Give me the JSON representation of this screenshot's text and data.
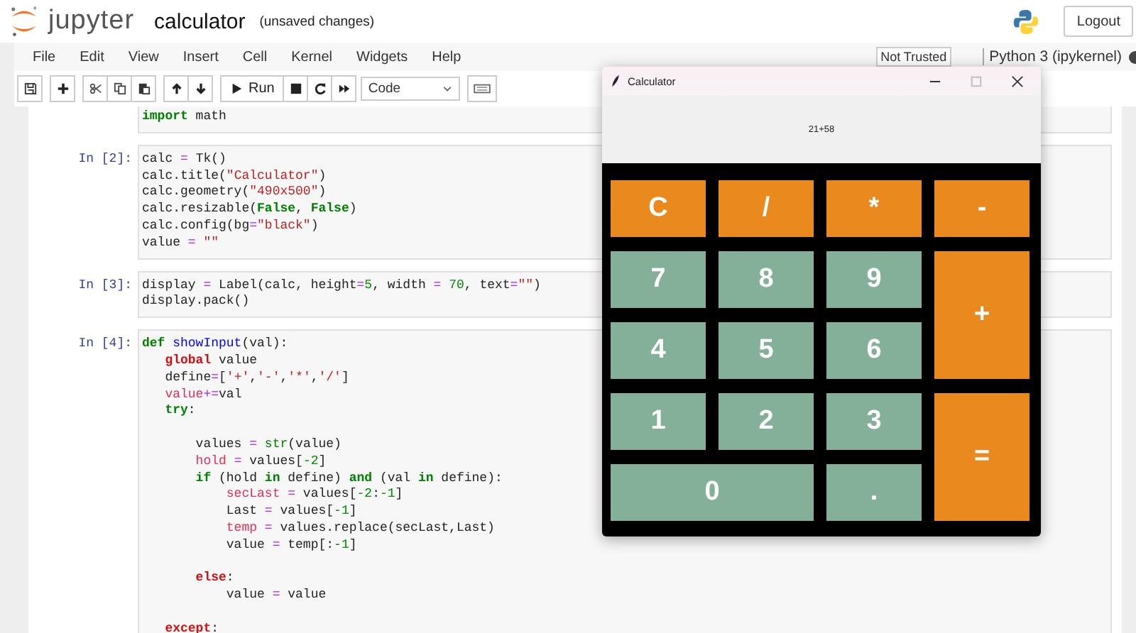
{
  "header": {
    "brand": "jupyter",
    "notebook_name": "calculator",
    "save_status": "(unsaved changes)",
    "logout": "Logout"
  },
  "menu": [
    "File",
    "Edit",
    "View",
    "Insert",
    "Cell",
    "Kernel",
    "Widgets",
    "Help"
  ],
  "trust": "Not Trusted",
  "kernel": "Python 3 (ipykernel)",
  "toolbar": {
    "run": "Run",
    "cell_type": "Code"
  },
  "cells": [
    {
      "lines": [
        {
          "tokens": [
            {
              "t": "import",
              "kind": "keyword"
            },
            {
              "t": " math",
              "kind": "plain"
            }
          ]
        }
      ]
    },
    {
      "prompt": "In [2]:",
      "lines": [
        {
          "tokens": [
            {
              "t": "calc ",
              "kind": "plain"
            },
            {
              "t": "=",
              "kind": "operator"
            },
            {
              "t": " Tk()",
              "kind": "plain"
            }
          ]
        },
        {
          "tokens": [
            {
              "t": "calc.title(",
              "kind": "plain"
            },
            {
              "t": "\"Calculator\"",
              "kind": "string"
            },
            {
              "t": ")",
              "kind": "plain"
            }
          ]
        },
        {
          "tokens": [
            {
              "t": "calc.geometry(",
              "kind": "plain"
            },
            {
              "t": "\"490x500\"",
              "kind": "string"
            },
            {
              "t": ")",
              "kind": "plain"
            }
          ]
        },
        {
          "tokens": [
            {
              "t": "calc.resizable(",
              "kind": "plain"
            },
            {
              "t": "False",
              "kind": "keyword"
            },
            {
              "t": ", ",
              "kind": "plain"
            },
            {
              "t": "False",
              "kind": "keyword"
            },
            {
              "t": ")",
              "kind": "plain"
            }
          ]
        },
        {
          "tokens": [
            {
              "t": "calc.config(bg",
              "kind": "plain"
            },
            {
              "t": "=",
              "kind": "operator"
            },
            {
              "t": "\"black\"",
              "kind": "string"
            },
            {
              "t": ")",
              "kind": "plain"
            }
          ]
        },
        {
          "tokens": [
            {
              "t": "value ",
              "kind": "plain"
            },
            {
              "t": "=",
              "kind": "operator"
            },
            {
              "t": " \"\"",
              "kind": "string"
            }
          ]
        }
      ]
    },
    {
      "prompt": "In [3]:",
      "lines": [
        {
          "tokens": [
            {
              "t": "display ",
              "kind": "plain"
            },
            {
              "t": "=",
              "kind": "operator"
            },
            {
              "t": " Label(calc, height",
              "kind": "plain"
            },
            {
              "t": "=",
              "kind": "operator"
            },
            {
              "t": "5",
              "kind": "number"
            },
            {
              "t": ", width ",
              "kind": "plain"
            },
            {
              "t": "=",
              "kind": "operator"
            },
            {
              "t": " 70",
              "kind": "number"
            },
            {
              "t": ", text",
              "kind": "plain"
            },
            {
              "t": "=",
              "kind": "operator"
            },
            {
              "t": "\"\"",
              "kind": "string"
            },
            {
              "t": ")",
              "kind": "plain"
            }
          ]
        },
        {
          "tokens": [
            {
              "t": "display.pack()",
              "kind": "plain"
            }
          ]
        }
      ]
    },
    {
      "prompt": "In [4]:",
      "lines": [
        {
          "tokens": [
            {
              "t": "def",
              "kind": "keyword"
            },
            {
              "t": " showInput",
              "kind": "function"
            },
            {
              "t": "(val):",
              "kind": "plain"
            }
          ]
        },
        {
          "tokens": [
            {
              "t": "   global",
              "kind": "control"
            },
            {
              "t": " value",
              "kind": "plain"
            }
          ]
        },
        {
          "tokens": [
            {
              "t": "   define",
              "kind": "plain"
            },
            {
              "t": "=",
              "kind": "operator"
            },
            {
              "t": "[",
              "kind": "plain"
            },
            {
              "t": "'+'",
              "kind": "string"
            },
            {
              "t": ",",
              "kind": "plain"
            },
            {
              "t": "'-'",
              "kind": "string"
            },
            {
              "t": ",",
              "kind": "plain"
            },
            {
              "t": "'*'",
              "kind": "string"
            },
            {
              "t": ",",
              "kind": "plain"
            },
            {
              "t": "'/'",
              "kind": "string"
            },
            {
              "t": "]",
              "kind": "plain"
            }
          ]
        },
        {
          "tokens": [
            {
              "t": "   value",
              "kind": "variable"
            },
            {
              "t": "+=",
              "kind": "operator"
            },
            {
              "t": "val",
              "kind": "plain"
            }
          ]
        },
        {
          "tokens": [
            {
              "t": "   try",
              "kind": "keyword"
            },
            {
              "t": ":",
              "kind": "plain"
            }
          ]
        },
        {
          "blank_before": true,
          "tokens": [
            {
              "t": "       values ",
              "kind": "plain"
            },
            {
              "t": "=",
              "kind": "operator"
            },
            {
              "t": " str",
              "kind": "builtin"
            },
            {
              "t": "(value)",
              "kind": "plain"
            }
          ]
        },
        {
          "tokens": [
            {
              "t": "       hold",
              "kind": "variable"
            },
            {
              "t": " =",
              "kind": "operator"
            },
            {
              "t": " values[",
              "kind": "plain"
            },
            {
              "t": "-2",
              "kind": "number"
            },
            {
              "t": "]",
              "kind": "plain"
            }
          ]
        },
        {
          "tokens": [
            {
              "t": "       if",
              "kind": "keyword"
            },
            {
              "t": " (hold ",
              "kind": "plain"
            },
            {
              "t": "in",
              "kind": "keyword"
            },
            {
              "t": " define) ",
              "kind": "plain"
            },
            {
              "t": "and",
              "kind": "keyword"
            },
            {
              "t": " (val ",
              "kind": "plain"
            },
            {
              "t": "in",
              "kind": "keyword"
            },
            {
              "t": " define):",
              "kind": "plain"
            }
          ]
        },
        {
          "tokens": [
            {
              "t": "           secLast",
              "kind": "variable"
            },
            {
              "t": " =",
              "kind": "operator"
            },
            {
              "t": " values[",
              "kind": "plain"
            },
            {
              "t": "-2",
              "kind": "number"
            },
            {
              "t": ":",
              "kind": "plain"
            },
            {
              "t": "-1",
              "kind": "number"
            },
            {
              "t": "]",
              "kind": "plain"
            }
          ]
        },
        {
          "tokens": [
            {
              "t": "           Last ",
              "kind": "plain"
            },
            {
              "t": "=",
              "kind": "operator"
            },
            {
              "t": " values[",
              "kind": "plain"
            },
            {
              "t": "-1",
              "kind": "number"
            },
            {
              "t": "]",
              "kind": "plain"
            }
          ]
        },
        {
          "tokens": [
            {
              "t": "           temp",
              "kind": "variable"
            },
            {
              "t": " =",
              "kind": "operator"
            },
            {
              "t": " values.replace(secLast,Last)",
              "kind": "plain"
            }
          ]
        },
        {
          "tokens": [
            {
              "t": "           value ",
              "kind": "plain"
            },
            {
              "t": "=",
              "kind": "operator"
            },
            {
              "t": " temp[:",
              "kind": "plain"
            },
            {
              "t": "-1",
              "kind": "number"
            },
            {
              "t": "]",
              "kind": "plain"
            }
          ]
        },
        {
          "blank_before": true,
          "tokens": [
            {
              "t": "       else",
              "kind": "control"
            },
            {
              "t": ":",
              "kind": "plain"
            }
          ]
        },
        {
          "tokens": [
            {
              "t": "           value ",
              "kind": "plain"
            },
            {
              "t": "=",
              "kind": "operator"
            },
            {
              "t": " value",
              "kind": "plain"
            }
          ]
        },
        {
          "blank_before": true,
          "tokens": [
            {
              "t": "   except",
              "kind": "control"
            },
            {
              "t": ":",
              "kind": "plain"
            }
          ]
        }
      ]
    }
  ],
  "calculator": {
    "title": "Calculator",
    "display": "21+58",
    "keys": [
      {
        "label": "C",
        "kind": "op",
        "tall": false,
        "wide": false
      },
      {
        "label": "/",
        "kind": "op",
        "tall": false,
        "wide": false
      },
      {
        "label": "*",
        "kind": "op",
        "tall": false,
        "wide": false
      },
      {
        "label": "-",
        "kind": "op",
        "tall": false,
        "wide": false
      },
      {
        "label": "7",
        "kind": "digit",
        "tall": false,
        "wide": false
      },
      {
        "label": "8",
        "kind": "digit",
        "tall": false,
        "wide": false
      },
      {
        "label": "9",
        "kind": "digit",
        "tall": false,
        "wide": false
      },
      {
        "label": "+",
        "kind": "op",
        "tall": true,
        "wide": false
      },
      {
        "label": "4",
        "kind": "digit",
        "tall": false,
        "wide": false
      },
      {
        "label": "5",
        "kind": "digit",
        "tall": false,
        "wide": false
      },
      {
        "label": "6",
        "kind": "digit",
        "tall": false,
        "wide": false
      },
      {
        "label": "1",
        "kind": "digit",
        "tall": false,
        "wide": false
      },
      {
        "label": "2",
        "kind": "digit",
        "tall": false,
        "wide": false
      },
      {
        "label": "3",
        "kind": "digit",
        "tall": false,
        "wide": false
      },
      {
        "label": "=",
        "kind": "op",
        "tall": true,
        "wide": false
      },
      {
        "label": "0",
        "kind": "digit",
        "tall": false,
        "wide": true
      },
      {
        "label": ".",
        "kind": "digit",
        "tall": false,
        "wide": false
      }
    ]
  }
}
